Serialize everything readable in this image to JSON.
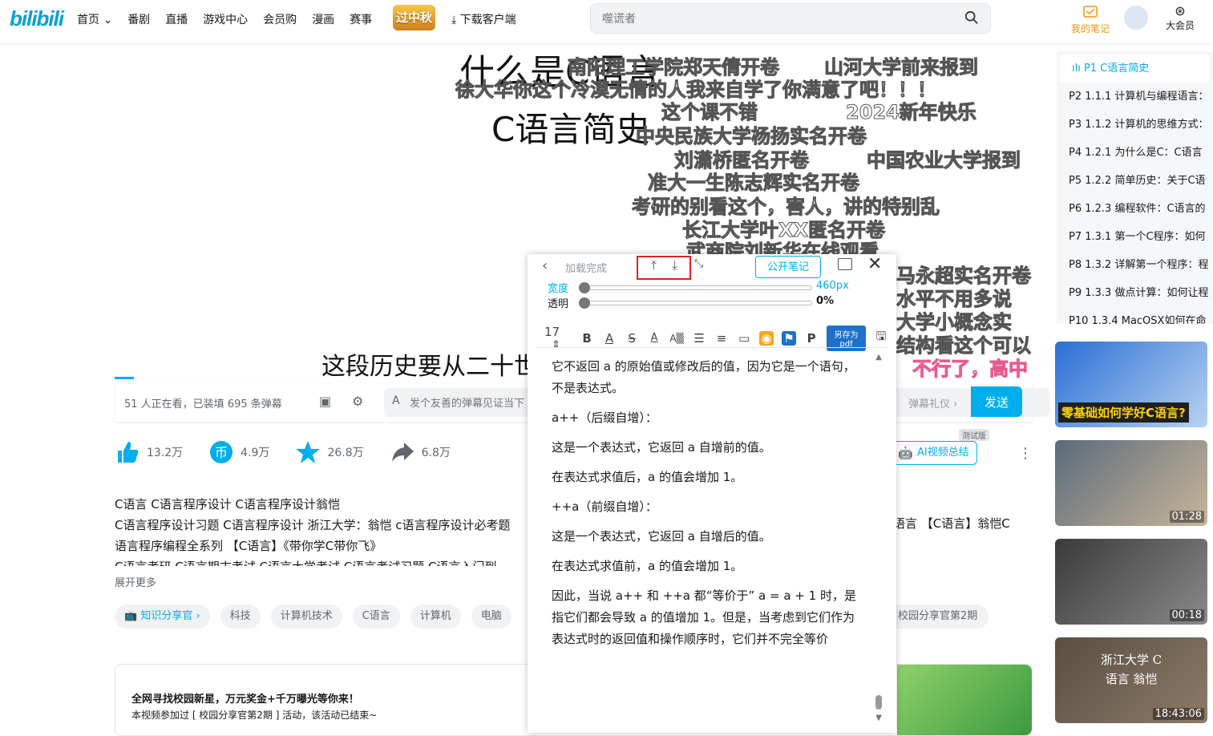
{
  "header": {
    "logo": "bilibili",
    "nav": [
      "首页 ⌄",
      "番剧",
      "直播",
      "游戏中心",
      "会员购",
      "漫画",
      "赛事"
    ],
    "promo": "过中秋",
    "download": "下载客户端",
    "search_placeholder": "噬谎者",
    "my_notes": "我的笔记",
    "vip": "大会员"
  },
  "video": {
    "title_line1": "什么是C语言",
    "title_line2": "C语言简史",
    "subtitle": "这段历史要从二十世纪",
    "danmaku": [
      "南阳理工学院郑天倩开卷",
      "山河大学前来报到",
      "徐大华你这个冷漠无情的人我来自学了你满意了吧！！！",
      "这个课不错",
      "2024新年快乐",
      "中央民族大学杨扬实名开卷",
      "刘潇桥匿名开卷",
      "中国农业大学报到",
      "准大一生陈志辉实名开卷",
      "考研的别看这个，害人，讲的特别乱",
      "长江大学叶XX匿名开卷",
      "武商院刘新华在线观看",
      "马永超实名开卷",
      "水平不用多说",
      "大学小概念实",
      "结构看这个可以",
      "不行了，高中"
    ]
  },
  "sendbar": {
    "watching": "51 人正在看，已装填 695 条弹幕",
    "placeholder": "发个友善的弹幕见证当下",
    "etiquette": "弹幕礼仪 ›",
    "send": "发送"
  },
  "actions": {
    "like": "13.2万",
    "coin": "4.9万",
    "fav": "26.8万",
    "share": "6.8万",
    "ai_summary": "AI视频总结",
    "test_badge": "测试版"
  },
  "description": {
    "lines": [
      "C语言 C语言程序设计 C语言程序设计翁恺",
      "C语言程序设计习题 C语言程序设计 浙江大学：翁恺 c语言程序设计必考题",
      "语言程序编程全系列 【C语言】《带你学C带你飞》",
      "C语言考研 C语言期末考试 C语言大学考试 C语言考试习题 C语言入门到..."
    ],
    "right_line": "语言 【C语言】翁恺C",
    "expand": "展开更多"
  },
  "tags": [
    "知识分享官 ›",
    "科技",
    "计算机技术",
    "C语言",
    "计算机",
    "电脑"
  ],
  "tag_right": "校园分享官第2期",
  "activity": {
    "title": "全网寻找校园新星，万元奖金+千万曝光等你来！",
    "text": "本视频参加过 [ 校园分享官第2期 ] 活动，该活动已结束~"
  },
  "playlist": [
    "P1  C语言简史",
    "P2  1.1.1 计算机与编程语言：",
    "P3  1.1.2 计算机的思维方式：",
    "P4  1.2.1 为什么是C：C语言",
    "P5  1.2.2 简单历史：关于C语",
    "P6  1.2.3 编程软件：C语言的",
    "P7  1.3.1 第一个C程序：如何",
    "P8  1.3.2 详解第一个程序：程",
    "P9  1.3.3 做点计算：如何让程",
    "P10  1.3.4 MacOSX如何在命"
  ],
  "recommend": [
    {
      "caption": "零基础如何学好C语言?",
      "duration": ""
    },
    {
      "caption": "",
      "duration": "01:28"
    },
    {
      "caption": "",
      "duration": "00:18"
    },
    {
      "caption": "浙江大学 C语言 翁恺",
      "duration": "18:43:06"
    }
  ],
  "notes": {
    "status": "加载完成",
    "public_btn": "公开笔记",
    "width_label": "宽度",
    "width_value": "460px",
    "opacity_label": "透明",
    "opacity_value": "0%",
    "font_size": "17",
    "pdf_btn": "另存为pdf",
    "paragraphs": [
      "它不返回 a 的原始值或修改后的值，因为它是一个语句，不是表达式。",
      "a++（后缀自增）：",
      "这是一个表达式，它返回 a 自增前的值。",
      "在表达式求值后，a 的值会增加 1。",
      "++a（前缀自增）：",
      "这是一个表达式，它返回 a 自增后的值。",
      "在表达式求值前，a 的值会增加 1。",
      "因此，当说 a++ 和 ++a 都“等价于” a = a + 1 时，是指它们都会导致 a 的值增加 1。但是，当考虑到它们作为表达式时的返回值和操作顺序时，它们并不完全等价"
    ]
  },
  "colors": {
    "accent": "#00aeec",
    "highlight_box": "#e0201c",
    "vip_orange": "#f69414"
  }
}
